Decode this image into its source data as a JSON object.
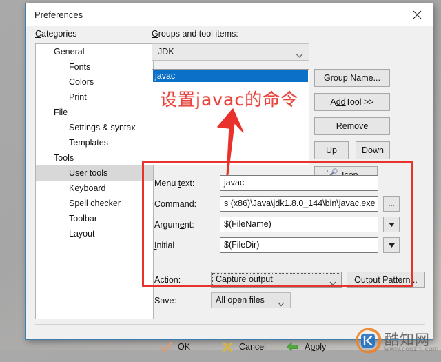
{
  "window": {
    "title": "Preferences",
    "close_icon": "close-icon"
  },
  "categories": {
    "label": "Categories",
    "label_accel": "C",
    "items": [
      {
        "text": "General",
        "level": 1,
        "selected": false
      },
      {
        "text": "Fonts",
        "level": 2,
        "selected": false
      },
      {
        "text": "Colors",
        "level": 2,
        "selected": false
      },
      {
        "text": "Print",
        "level": 2,
        "selected": false
      },
      {
        "text": "File",
        "level": 1,
        "selected": false
      },
      {
        "text": "Settings & syntax",
        "level": 2,
        "selected": false
      },
      {
        "text": "Templates",
        "level": 2,
        "selected": false
      },
      {
        "text": "Tools",
        "level": 1,
        "selected": false
      },
      {
        "text": "User tools",
        "level": 2,
        "selected": true
      },
      {
        "text": "Keyboard",
        "level": 2,
        "selected": false
      },
      {
        "text": "Spell checker",
        "level": 2,
        "selected": false
      },
      {
        "text": "Toolbar",
        "level": 2,
        "selected": false
      },
      {
        "text": "Layout",
        "level": 2,
        "selected": false
      }
    ]
  },
  "groups": {
    "label": "Groups and tool items:",
    "label_accel": "G",
    "selected_group": "JDK",
    "list_selected_item": "javac"
  },
  "annotation": {
    "text": "设置javac的命令",
    "color": "#e8433c",
    "arrow_color": "#e8322b",
    "rect_color": "#e8322b"
  },
  "side_buttons": {
    "group_name": "Group Name...",
    "add_tool_pre": "A",
    "add_tool_accel": "dd",
    "add_tool_post": " Tool >>",
    "remove_pre": "",
    "remove_accel": "R",
    "remove_post": "emove",
    "up": "Up",
    "down": "Down",
    "icon": "Icon...",
    "icon_glyph": "tool-icon"
  },
  "form": {
    "menu_text": {
      "label_pre": "Menu ",
      "label_accel": "t",
      "label_post": "ext:",
      "value": "javac"
    },
    "command": {
      "label_pre": "C",
      "label_accel": "o",
      "label_post": "mmand:",
      "value": "s (x86)\\Java\\jdk1.8.0_144\\bin\\javac.exe",
      "browse_label": "...",
      "browse_icon": "ellipsis-icon"
    },
    "argument": {
      "label_pre": "Argum",
      "label_accel": "e",
      "label_post": "nt:",
      "value": "$(FileName)",
      "dropdown_icon": "chevron-down-icon"
    },
    "initial": {
      "label_pre": "",
      "label_accel": "I",
      "label_post": "nitial",
      "value": "$(FileDir)",
      "dropdown_icon": "chevron-down-icon"
    },
    "action": {
      "label": "Action:",
      "value": "Capture output",
      "button_label": "Output Pattern...",
      "dropdown_icon": "chevron-down-icon"
    },
    "save": {
      "label": "Save:",
      "value": "All open files",
      "dropdown_icon": "chevron-down-icon"
    }
  },
  "footer": {
    "ok": {
      "label": "OK",
      "icon": "check-icon",
      "color": "#e09a74"
    },
    "cancel": {
      "label": "Cancel",
      "icon": "cross-icon",
      "color": "#d8b63a"
    },
    "apply_pre": "A",
    "apply_accel": "p",
    "apply_post": "ply",
    "apply_label": "Apply",
    "apply_icon": "arrow-left-icon",
    "apply_color": "#4faa3c"
  },
  "watermark": {
    "text": "酷知网",
    "url": "www.coozhi.com",
    "logo_icon": "coozhi-logo-icon"
  }
}
